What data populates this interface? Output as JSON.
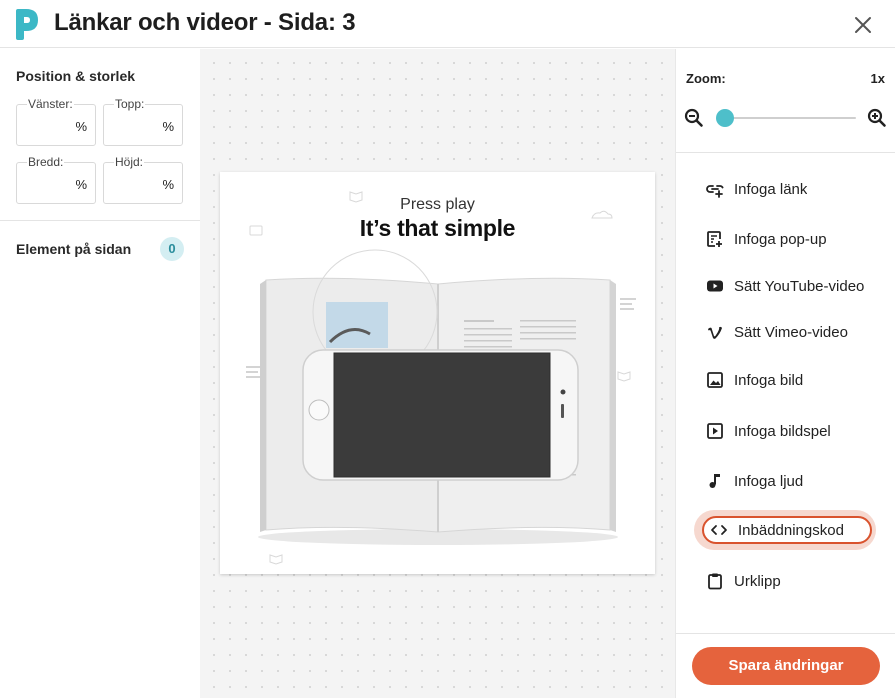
{
  "header": {
    "title": "Länkar och videor - Sida: 3",
    "logo_icon": "flipbook-logo-icon",
    "close_icon": "close-icon"
  },
  "left_panel": {
    "position_title": "Position & storlek",
    "fields": [
      {
        "label": "Vänster:",
        "unit": "%",
        "value": ""
      },
      {
        "label": "Topp:",
        "unit": "%",
        "value": ""
      },
      {
        "label": "Bredd:",
        "unit": "%",
        "value": ""
      },
      {
        "label": "Höjd:",
        "unit": "%",
        "value": ""
      }
    ],
    "elements_title": "Element på sidan",
    "elements_count": "0"
  },
  "canvas": {
    "page_heading_small": "Press play",
    "page_heading_large": "It’s that simple"
  },
  "right_panel": {
    "zoom_label": "Zoom:",
    "zoom_value": "1x",
    "zoom_level": 0,
    "menu": [
      {
        "label": "Infoga länk",
        "icon": "link-add-icon"
      },
      {
        "label": "Infoga pop-up",
        "icon": "popup-add-icon"
      },
      {
        "label": "Sätt YouTube-video",
        "icon": "youtube-icon"
      },
      {
        "label": "Sätt Vimeo-video",
        "icon": "vimeo-icon"
      },
      {
        "label": "Infoga bild",
        "icon": "image-icon"
      },
      {
        "label": "Infoga bildspel",
        "icon": "slideshow-icon"
      },
      {
        "label": "Infoga ljud",
        "icon": "music-note-icon"
      },
      {
        "label": "Inbäddningskod",
        "icon": "code-icon"
      },
      {
        "label": "Urklipp",
        "icon": "clipboard-icon"
      }
    ],
    "save_label": "Spara ändringar"
  },
  "colors": {
    "accent": "#e5633d",
    "teal": "#4ebfca",
    "active_border": "#d9532e"
  }
}
